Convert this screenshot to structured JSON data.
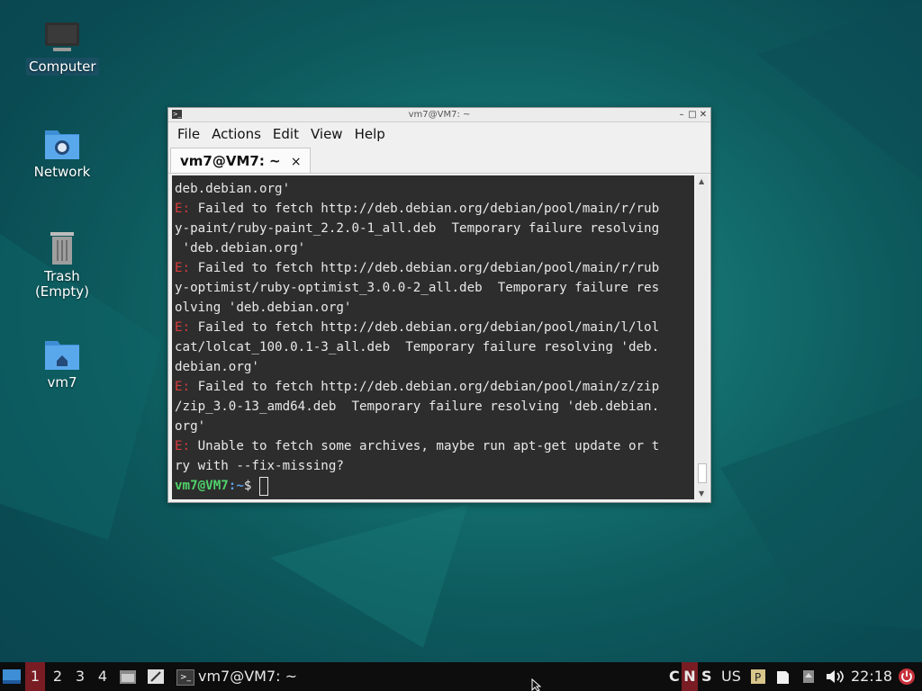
{
  "desktop": {
    "icons": [
      {
        "label": "Computer",
        "icon": "computer-icon"
      },
      {
        "label": "Network",
        "icon": "network-folder-icon"
      },
      {
        "label": "Trash",
        "sublabel": "(Empty)",
        "icon": "trash-icon"
      },
      {
        "label": "vm7",
        "icon": "home-folder-icon"
      }
    ]
  },
  "window": {
    "title": "vm7@VM7: ~",
    "menu": [
      "File",
      "Actions",
      "Edit",
      "View",
      "Help"
    ],
    "tab_label": "vm7@VM7: ~",
    "tab_close": "×",
    "terminal_lines": [
      {
        "text": "deb.debian.org'"
      },
      {
        "prefix": "E: ",
        "text": "Failed to fetch http://deb.debian.org/debian/pool/main/r/rub"
      },
      {
        "text": "y-paint/ruby-paint_2.2.0-1_all.deb  Temporary failure resolving"
      },
      {
        "text": " 'deb.debian.org'"
      },
      {
        "prefix": "E: ",
        "text": "Failed to fetch http://deb.debian.org/debian/pool/main/r/rub"
      },
      {
        "text": "y-optimist/ruby-optimist_3.0.0-2_all.deb  Temporary failure res"
      },
      {
        "text": "olving 'deb.debian.org'"
      },
      {
        "prefix": "E: ",
        "text": "Failed to fetch http://deb.debian.org/debian/pool/main/l/lol"
      },
      {
        "text": "cat/lolcat_100.0.1-3_all.deb  Temporary failure resolving 'deb."
      },
      {
        "text": "debian.org'"
      },
      {
        "prefix": "E: ",
        "text": "Failed to fetch http://deb.debian.org/debian/pool/main/z/zip"
      },
      {
        "text": "/zip_3.0-13_amd64.deb  Temporary failure resolving 'deb.debian."
      },
      {
        "text": "org'"
      },
      {
        "prefix": "E: ",
        "text": "Unable to fetch some archives, maybe run apt-get update or t"
      },
      {
        "text": "ry with --fix-missing?"
      }
    ],
    "prompt_user": "vm7@VM7",
    "prompt_path": ":~",
    "prompt_symbol": "$ "
  },
  "taskbar": {
    "workspaces": [
      "1",
      "2",
      "3",
      "4"
    ],
    "active_workspace": "1",
    "task_label": "vm7@VM7: ~",
    "indicators": {
      "c": "C",
      "n": "N",
      "s": "S"
    },
    "keyboard_layout": "US",
    "clock": "22:18"
  }
}
